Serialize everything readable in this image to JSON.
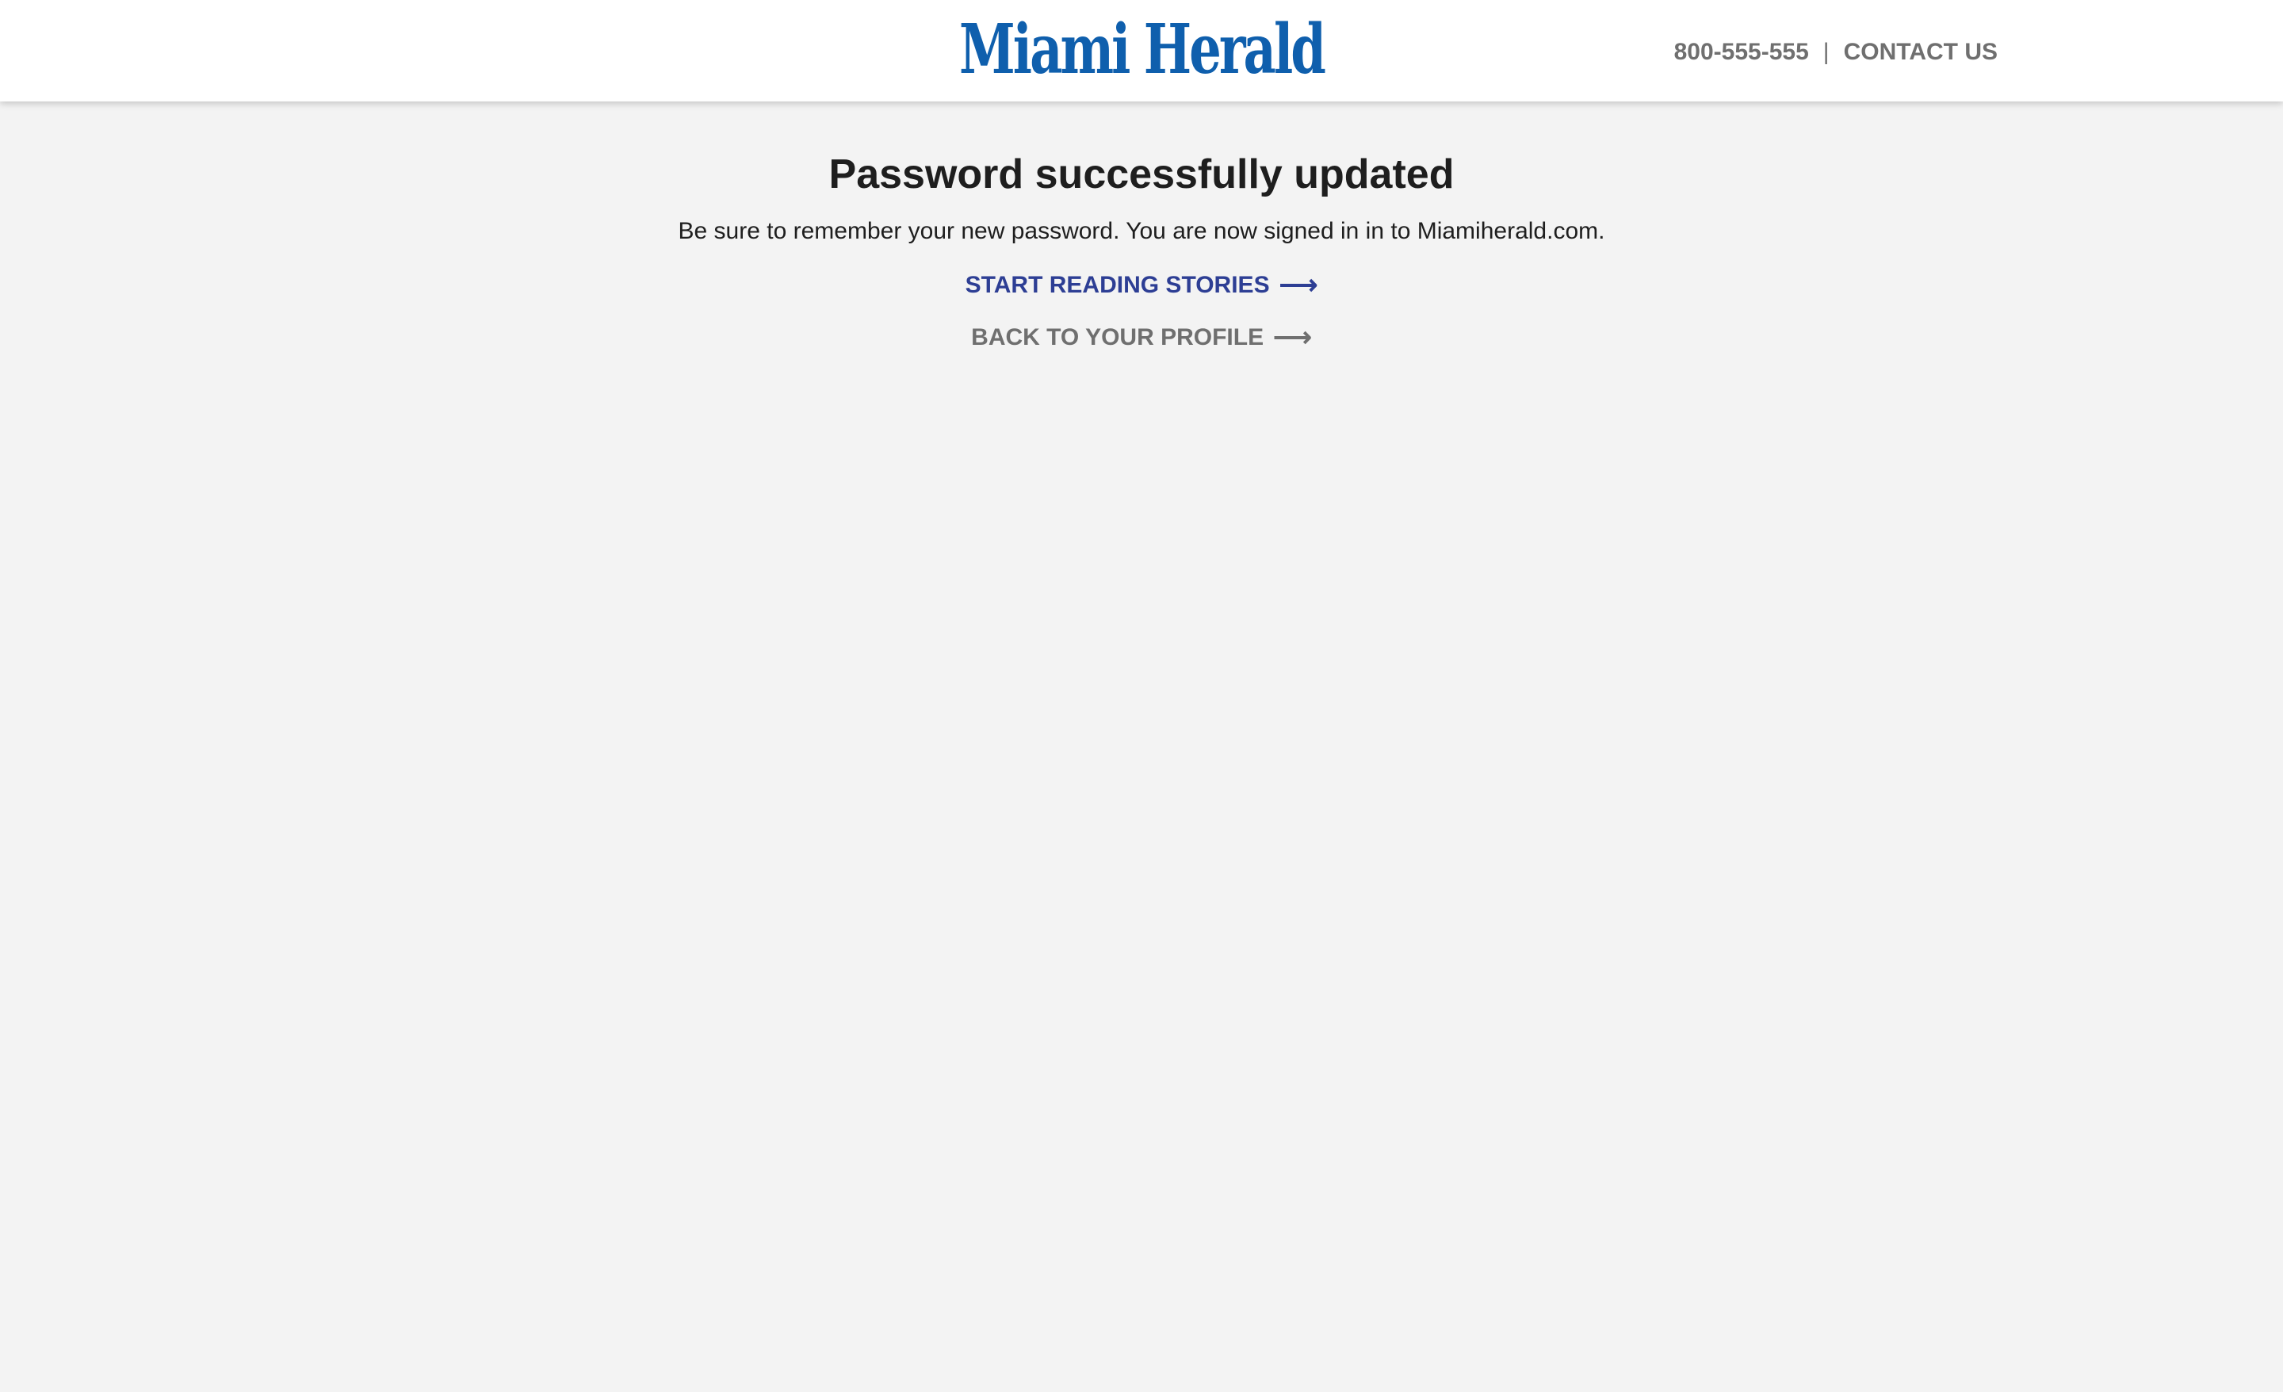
{
  "header": {
    "logo_text": "Miami Herald",
    "phone": "800-555-555",
    "separator": "|",
    "contact_label": "CONTACT US"
  },
  "main": {
    "title": "Password successfully updated",
    "message": "Be sure to remember your new password. You are now signed in in to Miamiherald.com.",
    "primary_link": {
      "label": "START READING STORIES",
      "arrow": "⟶"
    },
    "secondary_link": {
      "label": "BACK TO YOUR PROFILE",
      "arrow": "⟶"
    }
  },
  "colors": {
    "brand_blue": "#0f5fad",
    "link_blue": "#2d3e94",
    "gray_text": "#6f6f6f",
    "page_bg": "#f3f3f3",
    "header_bg": "#ffffff",
    "title_text": "#1e1e1e"
  },
  "icons": {
    "primary_link_arrow": "right-arrow-icon",
    "secondary_link_arrow": "right-arrow-icon"
  }
}
